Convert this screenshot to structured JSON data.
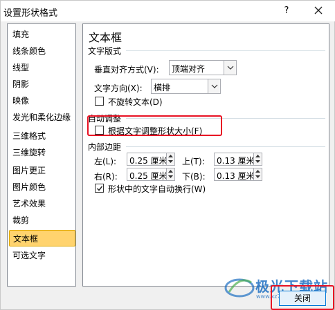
{
  "window": {
    "title": "设置形状格式",
    "help_label": "?"
  },
  "sidebar": {
    "items": [
      {
        "label": "填充"
      },
      {
        "label": "线条颜色"
      },
      {
        "label": "线型"
      },
      {
        "label": "阴影"
      },
      {
        "label": "映像"
      },
      {
        "label": "发光和柔化边缘"
      },
      {
        "label": "三维格式"
      },
      {
        "label": "三维旋转"
      },
      {
        "label": "图片更正"
      },
      {
        "label": "图片颜色"
      },
      {
        "label": "艺术效果"
      },
      {
        "label": "裁剪"
      },
      {
        "label": "文本框"
      },
      {
        "label": "可选文字"
      }
    ],
    "selected": "文本框"
  },
  "panel": {
    "title": "文本框",
    "layout_section": "文字版式",
    "vertical_align_label": "垂直对齐方式(V):",
    "vertical_align_value": "顶端对齐",
    "text_direction_label": "文字方向(X):",
    "text_direction_value": "横排",
    "no_rotate_label": "不旋转文本(D)",
    "autofit_section": "自动调整",
    "resize_shape_label": "根据文字调整形状大小(F)",
    "margins_section": "内部边距",
    "left_label": "左(L):",
    "left_value": "0.25 厘米",
    "top_label": "上(T):",
    "top_value": "0.13 厘米",
    "right_label": "右(R):",
    "right_value": "0.25 厘米",
    "bottom_label": "下(B):",
    "bottom_value": "0.13 厘米",
    "wrap_label": "形状中的文字自动换行(W)"
  },
  "checkboxes": {
    "no_rotate": false,
    "resize_shape": false,
    "wrap_text": true
  },
  "footer": {
    "close_label": "关闭"
  },
  "watermark": {
    "text": "极光下载站",
    "sub": "www.xz7.com"
  },
  "colors": {
    "highlight": "#e81123",
    "selected_item": "#ffd36e",
    "watermark": "#1e6fc2"
  }
}
